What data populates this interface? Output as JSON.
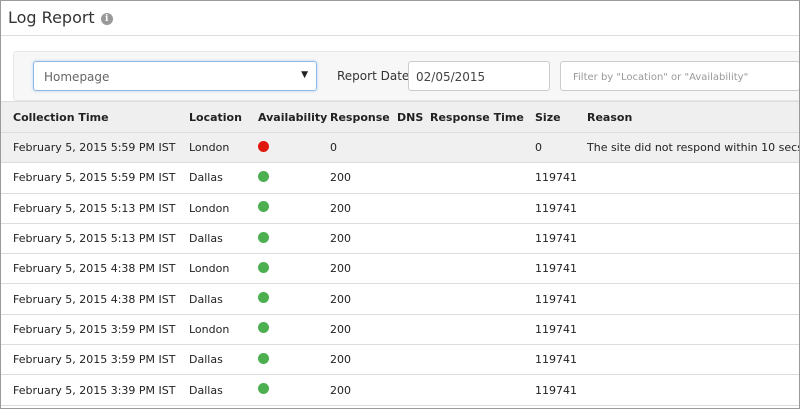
{
  "header": {
    "title": "Log Report",
    "info_icon": "i"
  },
  "filters": {
    "site_select": "Homepage",
    "report_date_label": "Report Date",
    "report_date": "02/05/2015",
    "filter_placeholder": "Filter by \"Location\" or \"Availability\""
  },
  "colors": {
    "up": "#4caf50",
    "down": "#e0190f"
  },
  "table": {
    "columns": [
      "Collection Time",
      "Location",
      "Availability",
      "Response",
      "DNS",
      "Response Time",
      "Size",
      "Reason"
    ],
    "rows": [
      {
        "time": "February 5, 2015 5:59 PM IST",
        "location": "London",
        "status": "down",
        "response": "0",
        "dns": "",
        "response_time": "",
        "size": "0",
        "reason": "The site did not respond within 10 secs."
      },
      {
        "time": "February 5, 2015 5:59 PM IST",
        "location": "Dallas",
        "status": "up",
        "response": "200",
        "dns": "",
        "response_time": "",
        "size": "119741",
        "reason": ""
      },
      {
        "time": "February 5, 2015 5:13 PM IST",
        "location": "London",
        "status": "up",
        "response": "200",
        "dns": "",
        "response_time": "",
        "size": "119741",
        "reason": ""
      },
      {
        "time": "February 5, 2015 5:13 PM IST",
        "location": "Dallas",
        "status": "up",
        "response": "200",
        "dns": "",
        "response_time": "",
        "size": "119741",
        "reason": ""
      },
      {
        "time": "February 5, 2015 4:38 PM IST",
        "location": "London",
        "status": "up",
        "response": "200",
        "dns": "",
        "response_time": "",
        "size": "119741",
        "reason": ""
      },
      {
        "time": "February 5, 2015 4:38 PM IST",
        "location": "Dallas",
        "status": "up",
        "response": "200",
        "dns": "",
        "response_time": "",
        "size": "119741",
        "reason": ""
      },
      {
        "time": "February 5, 2015 3:59 PM IST",
        "location": "London",
        "status": "up",
        "response": "200",
        "dns": "",
        "response_time": "",
        "size": "119741",
        "reason": ""
      },
      {
        "time": "February 5, 2015 3:59 PM IST",
        "location": "Dallas",
        "status": "up",
        "response": "200",
        "dns": "",
        "response_time": "",
        "size": "119741",
        "reason": ""
      },
      {
        "time": "February 5, 2015 3:39 PM IST",
        "location": "Dallas",
        "status": "up",
        "response": "200",
        "dns": "",
        "response_time": "",
        "size": "119741",
        "reason": ""
      }
    ]
  }
}
